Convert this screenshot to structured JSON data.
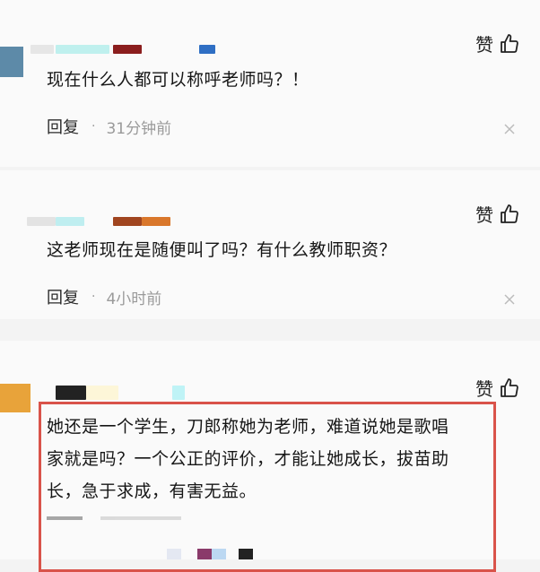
{
  "comments": [
    {
      "text": "现在什么人都可以称呼老师吗？！",
      "like_label": "赞",
      "reply_label": "回复",
      "time": "31分钟前",
      "avatar_color": "#5d8aa8",
      "name_colors": [
        "#e6e6e6",
        "#bff0ee",
        "#8b1e1e",
        "#2f6fc4"
      ]
    },
    {
      "text": "这老师现在是随便叫了吗？有什么教师职资？",
      "like_label": "赞",
      "reply_label": "回复",
      "time": "4小时前",
      "name_colors": [
        "#e3e3e3",
        "#bfeef0",
        "#a0451f",
        "#d9772b"
      ]
    },
    {
      "text_lines": [
        "她还是一个学生，刀郎称她为老师，难道说她是歌唱",
        "家就是吗？一个公正的评价，才能让她成长，拔苗助",
        "长，急于求成，有害无益。"
      ],
      "like_label": "赞",
      "avatar_color": "#e8a33a",
      "name_colors": [
        "#222222",
        "#fdf6d8",
        "#bff3f6"
      ]
    }
  ],
  "highlight_color": "#d9534a"
}
